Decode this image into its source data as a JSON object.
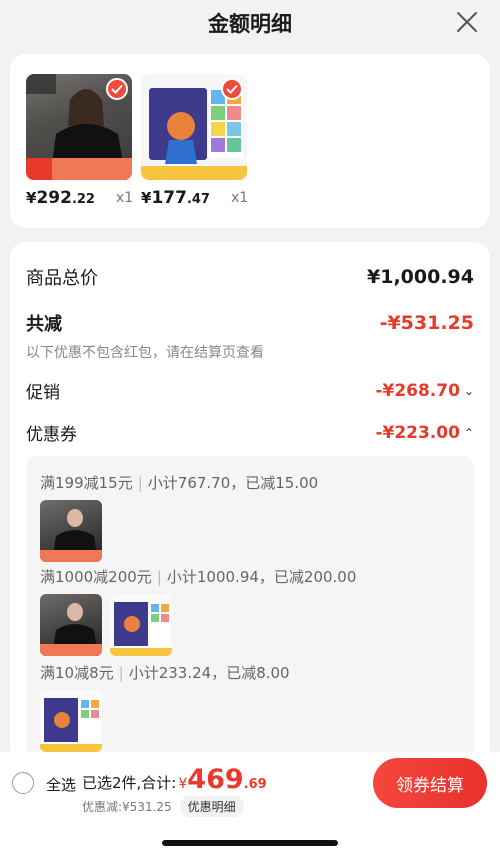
{
  "header": {
    "title": "金额明细"
  },
  "products": [
    {
      "price_symbol": "¥",
      "price_int": "292",
      "price_dec": ".22",
      "qty": "x1"
    },
    {
      "price_symbol": "¥",
      "price_int": "177",
      "price_dec": ".47",
      "qty": "x1"
    }
  ],
  "breakdown": {
    "total_label": "商品总价",
    "total_value": "¥1,000.94",
    "reduce_label": "共减",
    "reduce_value": "-¥531.25",
    "note": "以下优惠不包含红包，请在结算页查看",
    "promo_label": "促销",
    "promo_value": "-¥268.70",
    "coupon_label": "优惠券",
    "coupon_value": "-¥223.00"
  },
  "coupons": [
    {
      "rule": "满199减15元",
      "detail": "小计767.70，已减15.00"
    },
    {
      "rule": "满1000减200元",
      "detail": "小计1000.94，已减200.00"
    },
    {
      "rule": "满10减8元",
      "detail": "小计233.24，已减8.00"
    }
  ],
  "bottom": {
    "select_all": "全选",
    "selected_text": "已选2件,合计:",
    "total_symbol": "¥",
    "total_int": "469",
    "total_dec": ".69",
    "discount_text": "优惠减:¥531.25",
    "detail_link": "优惠明细",
    "checkout_button": "领券结算"
  },
  "colors": {
    "accent": "#e8392b",
    "brand_gradient_end": "#e8312a"
  },
  "icons": {
    "close": "close-icon",
    "check": "check-icon",
    "promo_chevron": "chevron-down-icon",
    "coupon_chevron": "chevron-up-icon"
  }
}
